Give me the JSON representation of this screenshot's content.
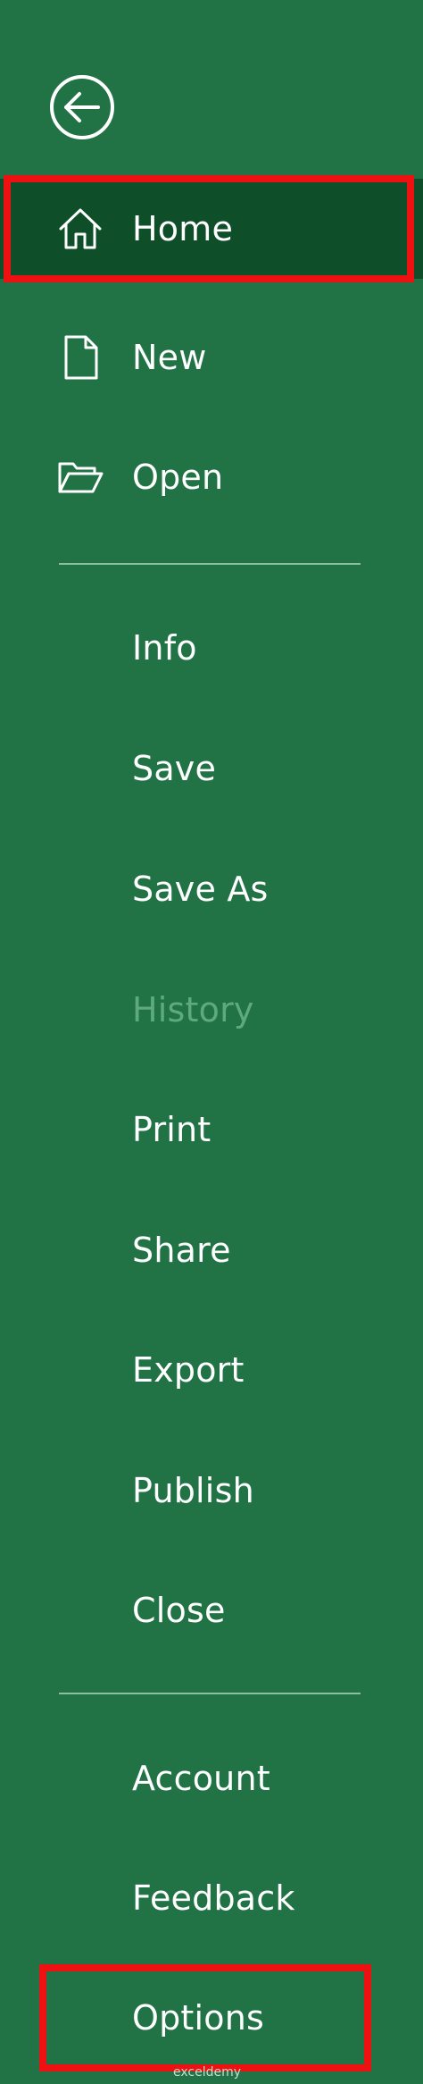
{
  "nav": {
    "home": "Home",
    "new": "New",
    "open": "Open",
    "info": "Info",
    "save": "Save",
    "save_as": "Save As",
    "history": "History",
    "print": "Print",
    "share": "Share",
    "export": "Export",
    "publish": "Publish",
    "close": "Close",
    "account": "Account",
    "feedback": "Feedback",
    "options": "Options"
  },
  "watermark": "exceldemy",
  "icons": {
    "back": "back-arrow-icon",
    "home": "home-icon",
    "new": "new-document-icon",
    "open": "folder-open-icon"
  },
  "colors": {
    "background": "#217346",
    "selected_background": "#0e4e29",
    "disabled_text": "#5fa97e",
    "highlight": "#ee1111",
    "divider": "#8cbfa0"
  },
  "state": {
    "selected": "Home",
    "disabled": [
      "History"
    ]
  }
}
